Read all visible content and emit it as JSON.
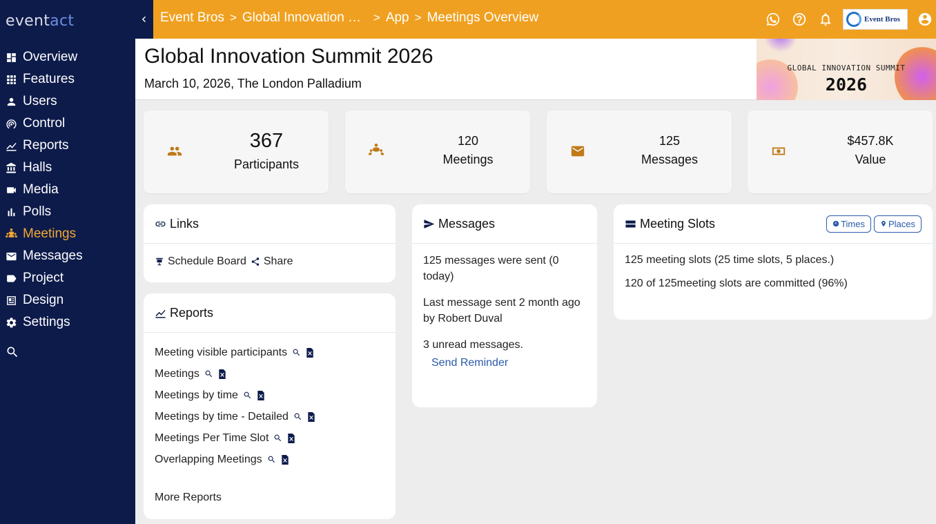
{
  "app": {
    "logo_part1": "event",
    "logo_part2": "act"
  },
  "sidebar": {
    "items": [
      {
        "label": "Overview",
        "icon": "dashboard-icon"
      },
      {
        "label": "Features",
        "icon": "grid-icon"
      },
      {
        "label": "Users",
        "icon": "user-icon"
      },
      {
        "label": "Control",
        "icon": "broadcast-icon"
      },
      {
        "label": "Reports",
        "icon": "chart-icon"
      },
      {
        "label": "Halls",
        "icon": "building-icon"
      },
      {
        "label": "Media",
        "icon": "video-icon"
      },
      {
        "label": "Polls",
        "icon": "bar-chart-icon"
      },
      {
        "label": "Meetings",
        "icon": "people-icon",
        "active": true
      },
      {
        "label": "Messages",
        "icon": "mail-icon"
      },
      {
        "label": "Project",
        "icon": "label-icon"
      },
      {
        "label": "Design",
        "icon": "design-icon"
      },
      {
        "label": "Settings",
        "icon": "gear-icon"
      }
    ]
  },
  "breadcrumb": {
    "items": [
      "Event Bros",
      "Global Innovation Summit 2026",
      "App",
      "Meetings Overview"
    ],
    "separator": ">"
  },
  "topbar": {
    "brand_logo_text": "Event Bros"
  },
  "event": {
    "title": "Global Innovation Summit 2026",
    "subtitle": "March 10, 2026, The London Palladium",
    "banner_line1": "GLOBAL INNOVATION SUMMIT",
    "banner_line2": "2026"
  },
  "stats": [
    {
      "value": "367",
      "label": "Participants",
      "icon": "people-icon"
    },
    {
      "value": "120",
      "label": "Meetings",
      "icon": "group-icon"
    },
    {
      "value": "125",
      "label": "Messages",
      "icon": "mail-icon"
    },
    {
      "value": "$457.8K",
      "label": "Value",
      "icon": "money-icon"
    }
  ],
  "links_panel": {
    "title": "Links",
    "schedule_board": "Schedule Board",
    "share": "Share"
  },
  "reports_panel": {
    "title": "Reports",
    "items": [
      "Meeting visible participants",
      "Meetings",
      "Meetings by time",
      "Meetings by time - Detailed",
      "Meetings Per Time Slot",
      "Overlapping Meetings"
    ],
    "more": "More Reports"
  },
  "messages_panel": {
    "title": "Messages",
    "line1": "125 messages were sent (0 today)",
    "line2": "Last message sent 2 month ago by Robert Duval",
    "line3": "3 unread messages.",
    "send_reminder": "Send Reminder"
  },
  "slots_panel": {
    "title": "Meeting Slots",
    "times_btn": "Times",
    "places_btn": "Places",
    "line1": "125 meeting slots (25 time slots, 5 places.)",
    "line2": "120 of 125meeting slots are committed (96%)"
  },
  "colors": {
    "sidebar": "#0d1b4b",
    "topbar": "#f0a020",
    "accent": "#f0a733",
    "link": "#2a5aaa"
  }
}
